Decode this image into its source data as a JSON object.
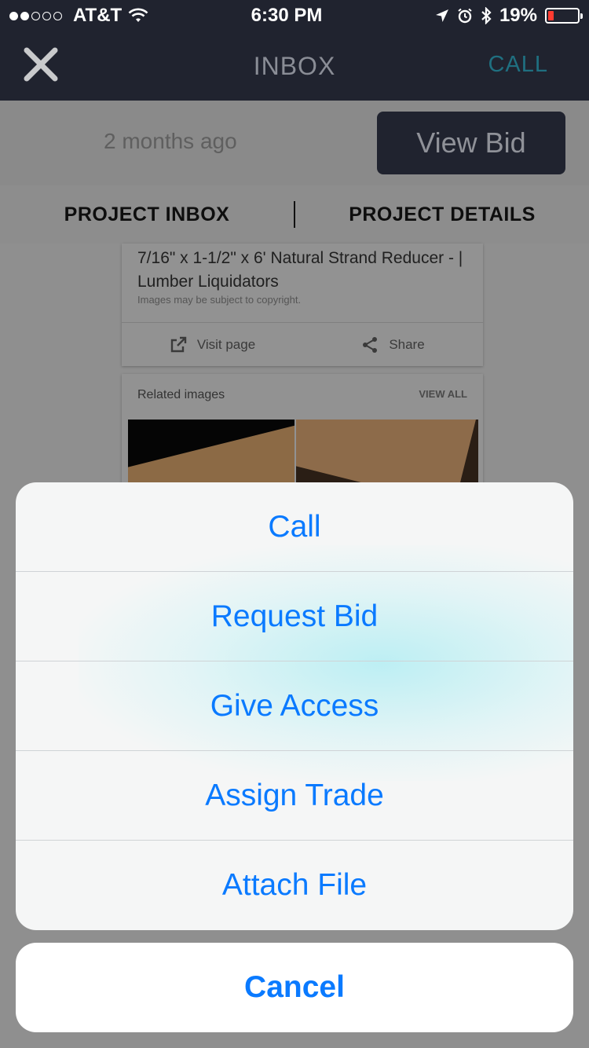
{
  "status_bar": {
    "carrier": "AT&T",
    "time": "6:30 PM",
    "battery_percent": "19%",
    "battery_level": 0.19,
    "icons": [
      "signal-dots",
      "wifi-icon",
      "location-arrow-icon",
      "alarm-icon",
      "bluetooth-icon",
      "battery-icon"
    ]
  },
  "nav": {
    "title": "INBOX",
    "call_label": "CALL",
    "close_icon": "close-icon"
  },
  "bid": {
    "time_ago": "2 months ago",
    "view_bid_label": "View Bid"
  },
  "tabs": {
    "project_inbox": "PROJECT INBOX",
    "project_details": "PROJECT DETAILS"
  },
  "content": {
    "card_title": "7/16\" x 1-1/2\" x 6' Natural Strand Reducer - | Lumber Liquidators",
    "card_note": "Images may be subject to copyright.",
    "visit_page": "Visit page",
    "share": "Share",
    "related_title": "Related images",
    "view_all": "VIEW ALL"
  },
  "action_sheet": {
    "items": [
      {
        "label": "Call"
      },
      {
        "label": "Request Bid"
      },
      {
        "label": "Give Access"
      },
      {
        "label": "Assign Trade"
      },
      {
        "label": "Attach File"
      }
    ],
    "cancel_label": "Cancel",
    "accent_color": "#0a7aff"
  }
}
